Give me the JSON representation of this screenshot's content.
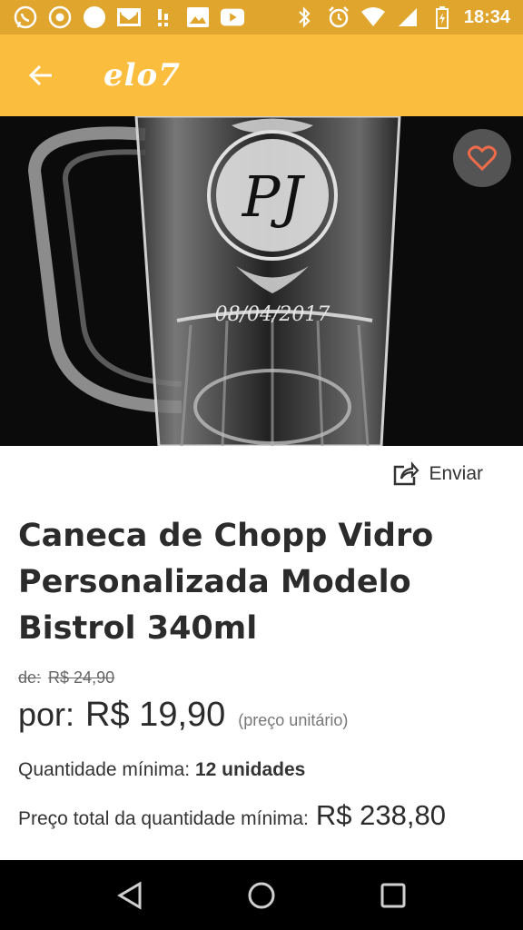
{
  "status_bar": {
    "time": "18:34",
    "left_icons": [
      "whatsapp-icon",
      "chrome-icon",
      "circle-icon",
      "gmail-icon",
      "notification-icon",
      "image-icon",
      "youtube-icon"
    ],
    "right_icons": [
      "bluetooth-icon",
      "alarm-icon",
      "wifi-icon",
      "signal-icon",
      "battery-icon"
    ],
    "color": "#e0a52c"
  },
  "app_bar": {
    "logo": "elo7",
    "color": "#fbbd3e"
  },
  "product_image": {
    "engraving_monogram": "PJ",
    "engraving_date": "08/04/2017"
  },
  "share": {
    "label": "Enviar"
  },
  "product": {
    "title": "Caneca de Chopp Vidro Personalizada Modelo Bistrol 340ml",
    "old_price_prefix": "de:",
    "old_price": "R$ 24,90",
    "price_prefix": "por:",
    "price": "R$ 19,90",
    "price_note": "(preço unitário)",
    "min_qty_label": "Quantidade mínima:",
    "min_qty_value": "12 unidades",
    "total_label": "Preço total da quantidade mínima:",
    "total_value": "R$ 238,80"
  },
  "nav_bar": {
    "buttons": [
      "back-nav-icon",
      "home-nav-icon",
      "recents-nav-icon"
    ]
  }
}
